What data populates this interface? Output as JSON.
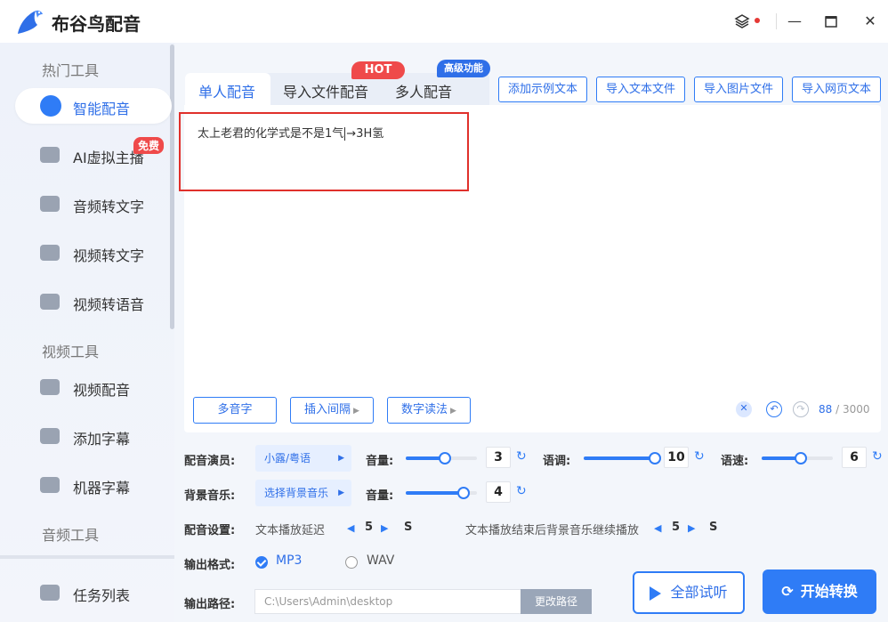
{
  "app": {
    "title": "布谷鸟配音"
  },
  "sidebar": {
    "sections": [
      "热门工具",
      "视频工具",
      "音频工具"
    ],
    "items": [
      {
        "label": "智能配音"
      },
      {
        "label": "AI虚拟主播",
        "badge": "免费"
      },
      {
        "label": "音频转文字"
      },
      {
        "label": "视频转文字"
      },
      {
        "label": "视频转语音"
      },
      {
        "label": "视频配音"
      },
      {
        "label": "添加字幕"
      },
      {
        "label": "机器字幕"
      },
      {
        "label": "任务列表"
      }
    ]
  },
  "tabs": {
    "items": [
      "单人配音",
      "导入文件配音",
      "多人配音"
    ],
    "hot_badge": "HOT",
    "advanced_badge": "高级功能"
  },
  "top_buttons": [
    "添加示例文本",
    "导入文本文件",
    "导入图片文件",
    "导入网页文本"
  ],
  "editor": {
    "text_before_caret": "太上老君的化学式是不是1气",
    "text_after_caret": "→3H氢",
    "buttons": [
      "多音字",
      "插入间隔",
      "数字读法"
    ],
    "count": "88",
    "max": "/ 3000"
  },
  "settings": {
    "voice_label": "配音演员:",
    "voice_value": "小露/粤语",
    "volume_label": "音量:",
    "volume_value": "3",
    "tone_label": "语调:",
    "tone_value": "10",
    "speed_label": "语速:",
    "speed_value": "6",
    "bgm_label": "背景音乐:",
    "bgm_value": "选择背景音乐",
    "bgm_volume_label": "音量:",
    "bgm_volume_value": "4",
    "dub_label": "配音设置:",
    "delay_label": "文本播放延迟",
    "delay_value": "5",
    "delay_unit": "S",
    "after_label": "文本播放结束后背景音乐继续播放",
    "after_value": "5",
    "after_unit": "S",
    "format_label": "输出格式:",
    "format_options": [
      "MP3",
      "WAV"
    ],
    "path_label": "输出路径:",
    "path_value": "C:\\Users\\Admin\\desktop",
    "path_button": "更改路径"
  },
  "actions": {
    "preview": "全部试听",
    "convert": "开始转换"
  },
  "colors": {
    "accent": "#2f7cf6",
    "highlight": "#e0302b",
    "hot": "#ef4a4a"
  }
}
